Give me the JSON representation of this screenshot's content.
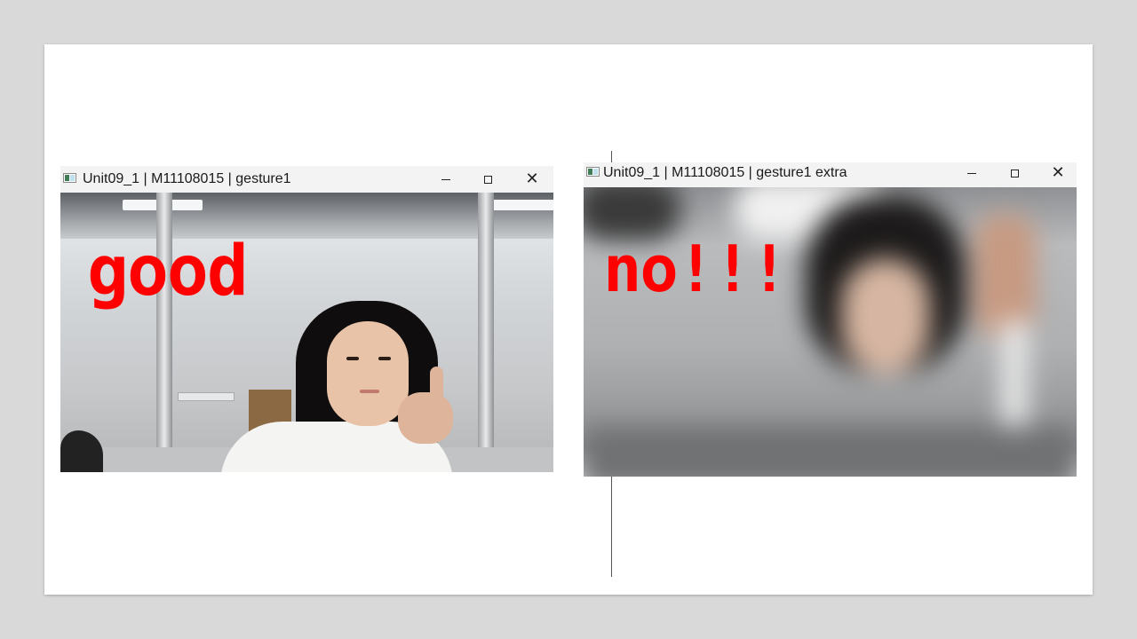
{
  "windows": [
    {
      "title": "Unit09_1 | M11108015 | gesture1",
      "overlay_text": "good",
      "overlay_color": "#ff0000"
    },
    {
      "title": "Unit09_1 | M11108015 | gesture1 extra",
      "overlay_text": "no!!!",
      "overlay_color": "#ff0000"
    }
  ],
  "icons": {
    "app": "app-window-icon",
    "minimize": "minimize-icon",
    "maximize": "maximize-icon",
    "close": "close-icon"
  },
  "colors": {
    "slide_background": "#ffffff",
    "page_background": "#d9d9d9",
    "titlebar": "#f3f3f3"
  }
}
